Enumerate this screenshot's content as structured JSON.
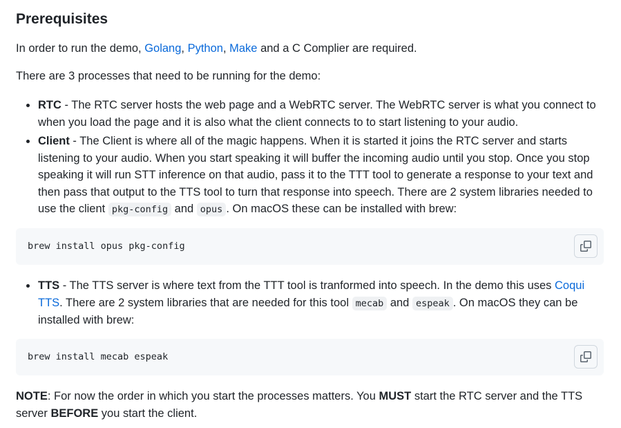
{
  "heading": "Prerequisites",
  "intro": {
    "before": "In order to run the demo, ",
    "link_golang": "Golang",
    "sep1": ", ",
    "link_python": "Python",
    "sep2": ", ",
    "link_make": "Make",
    "after": " and a C Complier are required."
  },
  "processes_text": "There are 3 processes that need to be running for the demo:",
  "rtc": {
    "term": "RTC",
    "text": " - The RTC server hosts the web page and a WebRTC server. The WebRTC server is what you connect to when you load the page and it is also what the client connects to to start listening to your audio."
  },
  "client": {
    "term": "Client",
    "text": " - The Client is where all of the magic happens. When it is started it joins the RTC server and starts listening to your audio. When you start speaking it will buffer the incoming audio until you stop. Once you stop speaking it will run STT inference on that audio, pass it to the TTT tool to generate a response to your text and then pass that output to the TTS tool to turn that response into speech. There are 2 system libraries needed to use the client ",
    "code1": "pkg-config",
    "mid": " and ",
    "code2": "opus",
    "end": ". On macOS these can be installed with brew:"
  },
  "code_block_1": "brew install opus pkg-config",
  "tts": {
    "term": "TTS",
    "text": " - The TTS server is where text from the TTT tool is tranformed into speech. In the demo this uses ",
    "link": "Coqui TTS",
    "text2": ". There are 2 system libraries that are needed for this tool ",
    "code1": "mecab",
    "mid": " and ",
    "code2": "espeak",
    "end": ". On macOS they can be installed with brew:"
  },
  "code_block_2": "brew install mecab espeak",
  "note": {
    "label": "NOTE",
    "text1": ": For now the order in which you start the processes matters. You ",
    "must": "MUST",
    "text2": " start the RTC server and the TTS server ",
    "before": "BEFORE",
    "text3": " you start the client."
  },
  "icons": {
    "copy": "copy-icon"
  },
  "colors": {
    "link": "#0969da",
    "text": "#1f2328",
    "code_bg": "#f6f8fa"
  }
}
